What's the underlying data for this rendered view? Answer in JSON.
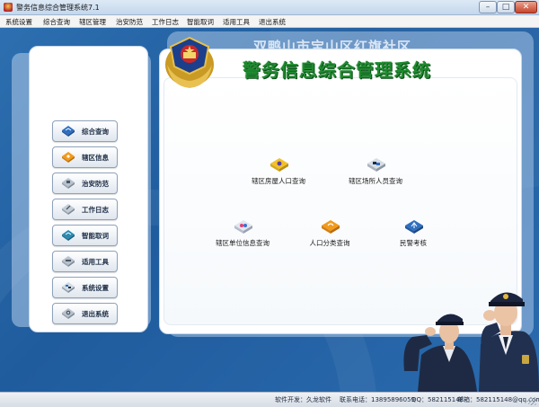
{
  "window": {
    "title": "警务信息综合管理系统7.1",
    "min": "–",
    "max": "□",
    "close": "✕"
  },
  "menu": [
    "系统设置",
    "综合查询",
    "辖区管理",
    "治安防范",
    "工作日志",
    "智能取词",
    "适用工具",
    "退出系统"
  ],
  "community_name": "双鸭山市宝山区红旗社区",
  "system_title": "警务信息综合管理系统",
  "sidebar": {
    "items": [
      {
        "label": "综合查询",
        "icon": "diamond-blue-icon"
      },
      {
        "label": "辖区信息",
        "icon": "diamond-orange-icon"
      },
      {
        "label": "治安防范",
        "icon": "diamond-gray-icon"
      },
      {
        "label": "工作日志",
        "icon": "diamond-gray-icon"
      },
      {
        "label": "智能取词",
        "icon": "diamond-teal-icon"
      },
      {
        "label": "适用工具",
        "icon": "diamond-gray-icon"
      },
      {
        "label": "系统设置",
        "icon": "diamond-blue-gray-icon"
      },
      {
        "label": "退出系统",
        "icon": "diamond-gray-icon"
      }
    ]
  },
  "functions": [
    {
      "label": "辖区房屋人口查询",
      "icon": "diamond-yellow-icon"
    },
    {
      "label": "辖区场所人员查询",
      "icon": "diamond-gray-icon"
    },
    {
      "label": "辖区单位信息查询",
      "icon": "diamond-pink-icon"
    },
    {
      "label": "人口分类查询",
      "icon": "diamond-orange-icon"
    },
    {
      "label": "民警考核",
      "icon": "diamond-blue-icon"
    }
  ],
  "status": {
    "developer": "软件开发：久龙软件",
    "phone": "联系电话：13895896059",
    "qq": "QQ：582115148",
    "email": "邮箱：582115148@qq.com"
  },
  "colors": {
    "background": "#2464a6",
    "title_green": "#1f8a2f",
    "accent_orange": "#f29a1c"
  }
}
